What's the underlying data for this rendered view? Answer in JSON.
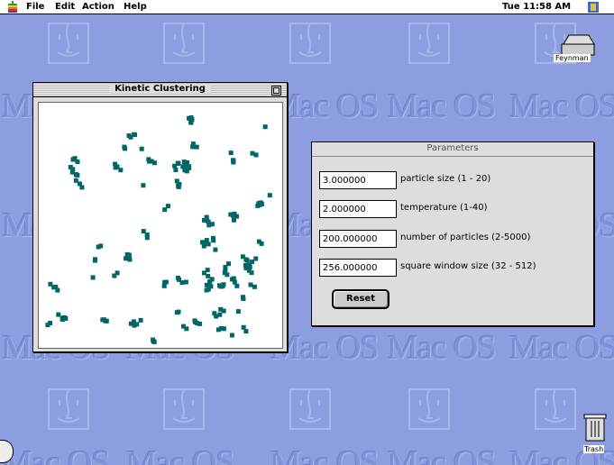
{
  "menubar": {
    "items": [
      "File",
      "Edit",
      "Action",
      "Help"
    ],
    "clock": "Tue 11:58 AM"
  },
  "desktop": {
    "watermark_text": "Mac OS",
    "hard_disk_label": "Feynman",
    "trash_label": "Trash"
  },
  "kinetic_window": {
    "title": "Kinetic Clustering",
    "particle_color": "#006666"
  },
  "params_window": {
    "title": "Parameters",
    "rows": [
      {
        "value": "3.000000",
        "label": "particle size (1 - 20)"
      },
      {
        "value": "2.000000",
        "label": "temperature (1-40)"
      },
      {
        "value": "200.000000",
        "label": "number of particles (2-5000)"
      },
      {
        "value": "256.000000",
        "label": "square window size (32 - 512)"
      }
    ],
    "reset_label": "Reset"
  }
}
